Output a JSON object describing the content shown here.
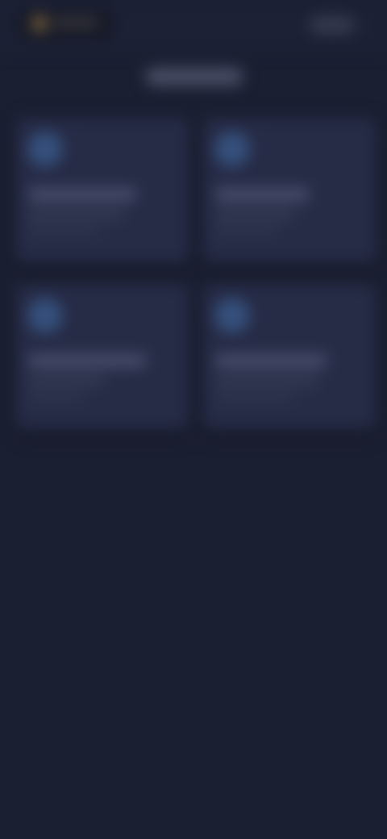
{
  "theme": {
    "background": "#1b1f32",
    "header_background": "#1c2135",
    "card_background": "#262b46",
    "icon_accent": "#35507c",
    "logo_accent": "#6e5a3c"
  },
  "header": {
    "logo_icon": "logo-icon",
    "action_icon": "menu-icon"
  },
  "cards": [
    {
      "icon": "category-icon"
    },
    {
      "icon": "category-icon"
    },
    {
      "icon": "category-icon"
    },
    {
      "icon": "category-icon"
    }
  ]
}
